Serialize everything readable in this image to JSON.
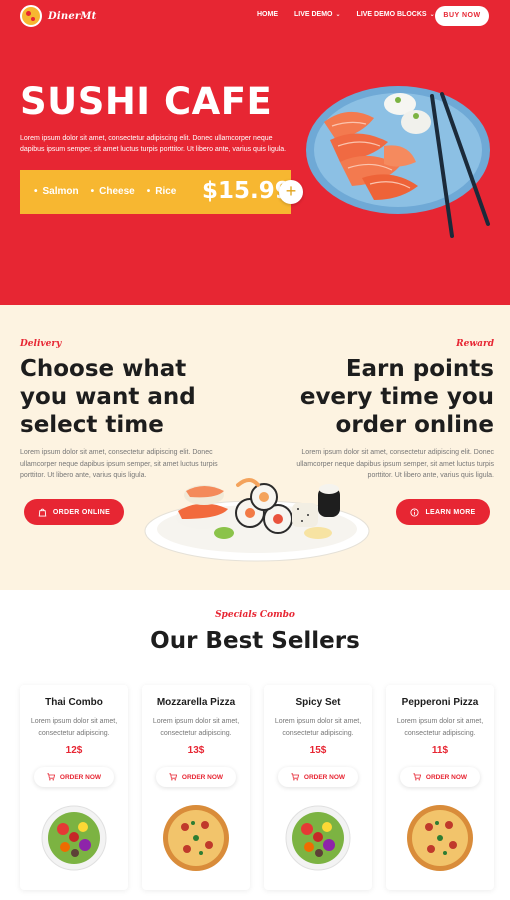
{
  "nav": {
    "logo_text": "DinerMt",
    "items": [
      {
        "label": "HOME"
      },
      {
        "label": "LIVE DEMO"
      },
      {
        "label": "LIVE DEMO BLOCKS"
      }
    ],
    "buy_label": "BUY NOW"
  },
  "hero": {
    "title": "SUSHI CAFE",
    "description": "Lorem ipsum dolor sit amet, consectetur adipiscing elit. Donec ullamcorper neque dapibus ipsum semper, sit amet luctus turpis porttitor. Ut libero ante, varius quis ligula.",
    "tags": [
      "Salmon",
      "Cheese",
      "Rice"
    ],
    "price": "$15.99",
    "colors": {
      "background": "#e72633",
      "price_bar": "#f7b731"
    }
  },
  "delivery": {
    "left_label": "Delivery",
    "left_title_lines": [
      "Choose what",
      "you want and",
      "select time"
    ],
    "left_description": "Lorem ipsum dolor sit amet, consectetur adipiscing elit. Donec ullamcorper neque dapibus ipsum semper, sit amet luctus turpis porttitor. Ut libero ante, varius quis ligula.",
    "left_button": "ORDER ONLINE",
    "right_label": "Reward",
    "right_title_lines": [
      "Earn points",
      "every time you",
      "order online"
    ],
    "right_description": "Lorem ipsum dolor sit amet, consectetur adipiscing elit. Donec ullamcorper neque dapibus ipsum semper, sit amet luctus turpis porttitor. Ut libero ante, varius quis ligula.",
    "right_button": "LEARN MORE"
  },
  "sellers": {
    "label": "Specials Combo",
    "title": "Our Best Sellers",
    "cards": [
      {
        "name": "Thai Combo",
        "desc": "Lorem ipsum dolor sit amet, consectetur adipiscing.",
        "price": "12$",
        "button": "ORDER NOW",
        "image": "salad"
      },
      {
        "name": "Mozzarella Pizza",
        "desc": "Lorem ipsum dolor sit amet, consectetur adipiscing.",
        "price": "13$",
        "button": "ORDER NOW",
        "image": "pizza"
      },
      {
        "name": "Spicy Set",
        "desc": "Lorem ipsum dolor sit amet, consectetur adipiscing.",
        "price": "15$",
        "button": "ORDER NOW",
        "image": "salad"
      },
      {
        "name": "Pepperoni Pizza",
        "desc": "Lorem ipsum dolor sit amet, consectetur adipiscing.",
        "price": "11$",
        "button": "ORDER NOW",
        "image": "pizza"
      }
    ]
  }
}
